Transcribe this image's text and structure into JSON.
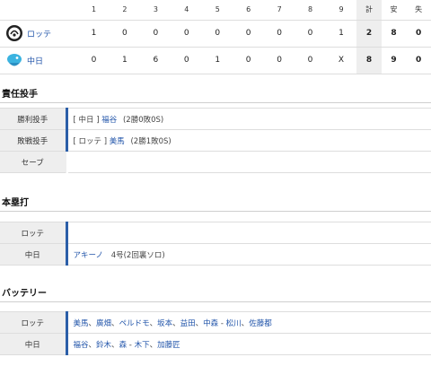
{
  "score": {
    "headers": [
      "1",
      "2",
      "3",
      "4",
      "5",
      "6",
      "7",
      "8",
      "9",
      "計",
      "安",
      "失"
    ],
    "rows": [
      {
        "team": "ロッテ",
        "innings": [
          "1",
          "0",
          "0",
          "0",
          "0",
          "0",
          "0",
          "0",
          "1"
        ],
        "r": "2",
        "h": "8",
        "e": "0"
      },
      {
        "team": "中日",
        "innings": [
          "0",
          "1",
          "6",
          "0",
          "1",
          "0",
          "0",
          "0",
          "X"
        ],
        "r": "8",
        "h": "9",
        "e": "0"
      }
    ]
  },
  "pitchers": {
    "title": "責任投手",
    "win_label": "勝利投手",
    "win_team": "[ 中日 ]",
    "win_name": "福谷",
    "win_record": "(2勝0敗0S)",
    "loss_label": "敗戦投手",
    "loss_team": "[ ロッテ ]",
    "loss_name": "美馬",
    "loss_record": "(2勝1敗0S)",
    "save_label": "セーブ"
  },
  "homeruns": {
    "title": "本塁打",
    "rows": [
      {
        "team": "ロッテ",
        "player": "",
        "detail": ""
      },
      {
        "team": "中日",
        "player": "アキーノ",
        "detail": "4号(2回裏ソロ)"
      }
    ]
  },
  "battery": {
    "title": "バッテリー",
    "lotte_label": "ロッテ",
    "lotte_p": [
      "美馬",
      "廣畑",
      "ペルドモ",
      "坂本",
      "益田",
      "中森"
    ],
    "lotte_c": [
      "松川",
      "佐藤都"
    ],
    "chunichi_label": "中日",
    "chunichi_p": [
      "福谷",
      "鈴木",
      "森"
    ],
    "chunichi_c": [
      "木下",
      "加藤匠"
    ]
  },
  "colors": {
    "accent": "#2b5ea8",
    "link": "#2255aa",
    "shade": "#eeeeee"
  }
}
